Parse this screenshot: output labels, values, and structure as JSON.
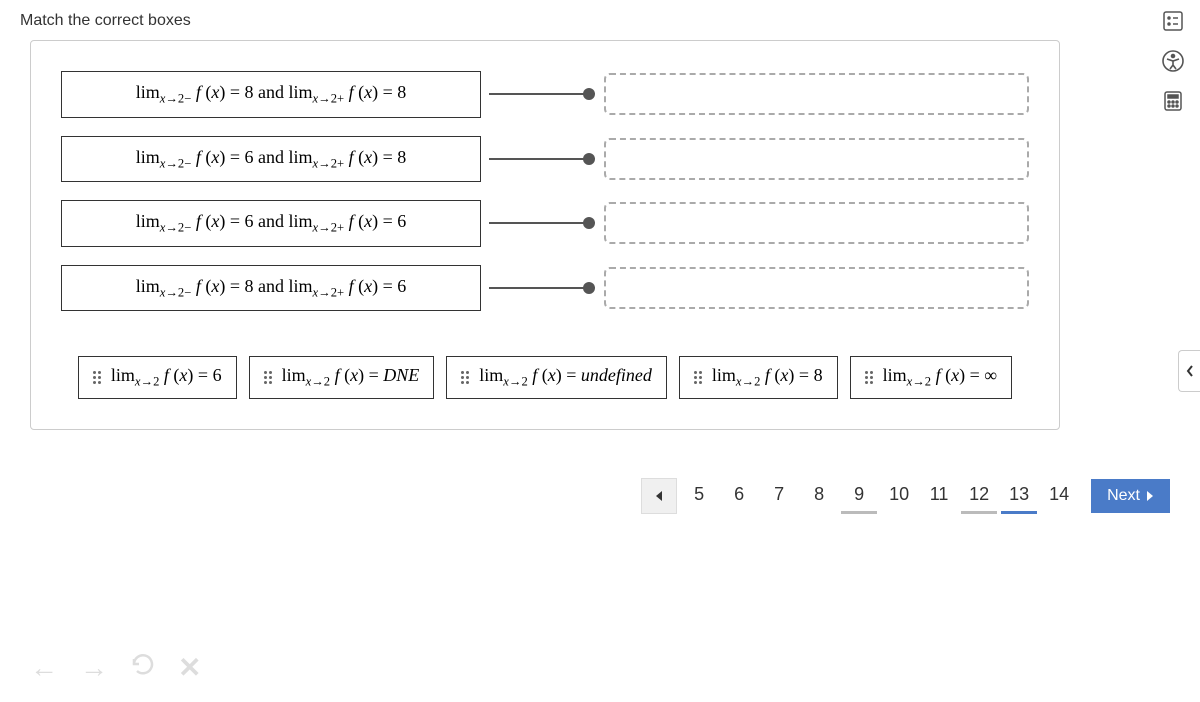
{
  "title": "Match the correct boxes",
  "rows": [
    {
      "left_a": "8",
      "left_b": "8"
    },
    {
      "left_a": "6",
      "left_b": "8"
    },
    {
      "left_a": "6",
      "left_b": "6"
    },
    {
      "left_a": "8",
      "left_b": "6"
    }
  ],
  "options": [
    {
      "label": "6"
    },
    {
      "label": "DNE",
      "italic": true
    },
    {
      "label": "undefined",
      "italic": true
    },
    {
      "label": "8"
    },
    {
      "label": "∞"
    }
  ],
  "pagination": {
    "pages": [
      "5",
      "6",
      "7",
      "8",
      "9",
      "10",
      "11",
      "12",
      "13",
      "14"
    ],
    "partial": [
      "9",
      "12"
    ],
    "active": "13",
    "next_label": "Next"
  },
  "nav": {
    "back": "←",
    "forward": "→",
    "reload": "↻",
    "close": "✕"
  }
}
